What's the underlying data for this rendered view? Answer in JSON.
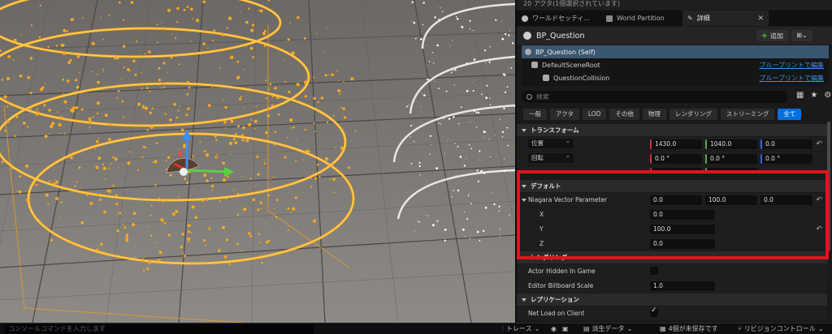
{
  "window": {
    "actor_count_text": "20 アクタ(1個選択されています)"
  },
  "tabs": [
    {
      "label": "ワールドセッティ..."
    },
    {
      "label": "World Partition"
    },
    {
      "label": "詳細"
    }
  ],
  "details": {
    "title": "BP_Question",
    "add_label": "追加",
    "components": [
      {
        "label": "BP_Question (Self)"
      },
      {
        "label": "DefaultSceneRoot",
        "link": "ブループリントで編集"
      },
      {
        "label": "QuestionCollision",
        "link": "ブループリントで編集"
      }
    ],
    "search_placeholder": "検索",
    "filters": [
      "一般",
      "アクタ",
      "LOD",
      "その他",
      "物理",
      "レンダリング",
      "ストリーミング",
      "全て"
    ],
    "sections": {
      "transform": "トランスフォーム",
      "default": "デフォルト",
      "rendering": "レンダリング",
      "replication": "レプリケーション"
    },
    "transform": {
      "location_label": "位置",
      "location": [
        "1430.0",
        "1040.0",
        "0.0"
      ],
      "rotation_label": "回転",
      "rotation": [
        "0.0 °",
        "0.0 °",
        "0.0 °"
      ]
    },
    "niagara": {
      "label": "Niagara Vector Parameter",
      "values": [
        "0.0",
        "100.0",
        "0.0"
      ],
      "x_label": "X",
      "x": "0.0",
      "y_label": "Y",
      "y": "100.0",
      "z_label": "Z",
      "z": "0.0"
    },
    "rendering": {
      "hidden_label": "Actor Hidden In Game",
      "billboard_label": "Editor Billboard Scale",
      "billboard_value": "1.0"
    },
    "replication": {
      "net_load_label": "Net Load on Client"
    }
  },
  "status": {
    "console_placeholder": "コンソールコマンドを入力します",
    "trace": "トレース",
    "derived": "派生データ",
    "unsaved": "4個が未保存です",
    "revision": "リビジョンコントロール"
  },
  "colors": {
    "accent": "#0070e0",
    "highlight_box": "#e0141c",
    "link": "#3d8fe8"
  }
}
